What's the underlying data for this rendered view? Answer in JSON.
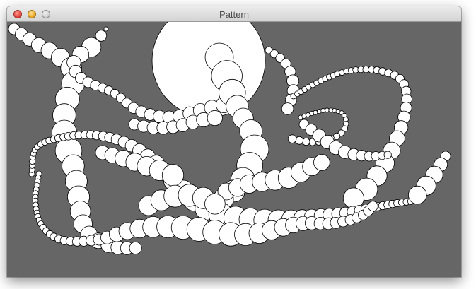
{
  "window": {
    "title": "Pattern"
  },
  "colors": {
    "canvas_background": "#666666",
    "circle_fill": "#ffffff",
    "circle_stroke": "#000000"
  },
  "icons": {
    "close": "close-icon",
    "minimize": "minimize-icon",
    "zoom": "zoom-icon"
  }
}
